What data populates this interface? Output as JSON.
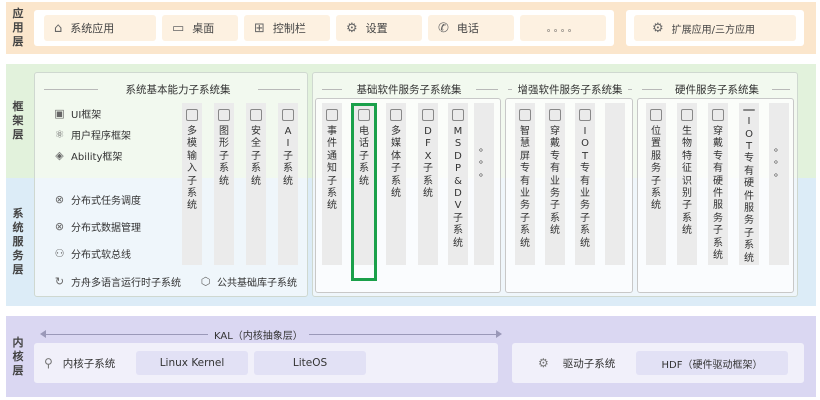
{
  "layers": {
    "app": "应用层",
    "framework": "框架层",
    "system_service": "系统服务层",
    "kernel": "内核层"
  },
  "app_layer": {
    "items": [
      {
        "icon": "⌂",
        "label": "系统应用"
      },
      {
        "icon": "▭",
        "label": "桌面"
      },
      {
        "icon": "⊞",
        "label": "控制栏"
      },
      {
        "icon": "⚙",
        "label": "设置"
      },
      {
        "icon": "✆",
        "label": "电话"
      },
      {
        "icon": "",
        "label": "。。。。"
      }
    ],
    "extension": {
      "icon": "⚙",
      "label": "扩展应用/三方应用"
    }
  },
  "groups": {
    "basic_capability": "系统基本能力子系统集",
    "basic_software": "基础软件服务子系统集",
    "enhanced_software": "增强软件服务子系统集",
    "hardware": "硬件服务子系统集"
  },
  "framework_items": [
    {
      "icon": "▣",
      "label": "UI框架"
    },
    {
      "icon": "⚛",
      "label": "用户程序框架"
    },
    {
      "icon": "◈",
      "label": "Ability框架"
    }
  ],
  "service_items": [
    {
      "icon": "⊗",
      "label": "分布式任务调度"
    },
    {
      "icon": "⊗",
      "label": "分布式数据管理"
    },
    {
      "icon": "⚇",
      "label": "分布式软总线"
    },
    {
      "icon": "↻",
      "label": "方舟多语言运行时子系统"
    },
    {
      "icon": "⬡",
      "label": "公共基础库子系统"
    }
  ],
  "columns": {
    "basic": [
      "多模输入子系统",
      "图形子系统",
      "安全子系统",
      "AI子系统"
    ],
    "software": [
      "事件通知子系统",
      "电话子系统",
      "多媒体子系统",
      "DFX子系统",
      "MSDP&DV子系统",
      "。。。"
    ],
    "enhanced": [
      "智慧屏专有业务子系统",
      "穿戴专有业务子系统",
      "IOT专有业务子系统",
      ""
    ],
    "hardware": [
      "位置服务子系统",
      "生物特征识别子系统",
      "穿戴专有硬件服务子系统",
      "IOT专有硬件服务子系统",
      "。。。"
    ]
  },
  "kernel_layer": {
    "kal": "KAL（内核抽象层）",
    "subsystem": "内核子系统",
    "linux": "Linux Kernel",
    "liteos": "LiteOS",
    "driver": "驱动子系统",
    "hdf": "HDF（硬件驱动框架）"
  },
  "colors": {
    "app_band": "#fbe6cc",
    "framework_band": "#e2f2dc",
    "service_band": "#dcecf7",
    "kernel_band": "#dad7f2",
    "highlight": "#1aa04a"
  }
}
